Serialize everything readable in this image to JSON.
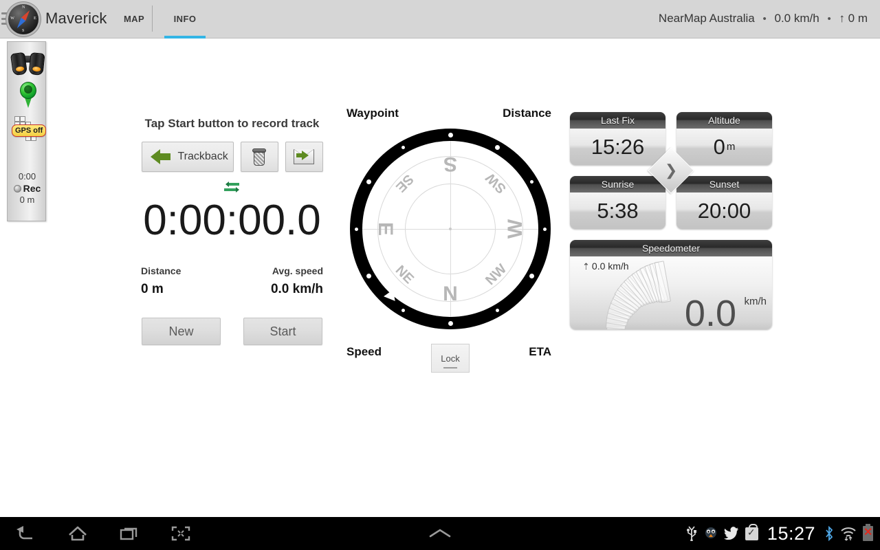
{
  "app": {
    "title": "Maverick",
    "icon": "compass-icon",
    "menu_icon": "hamburger-menu-icon"
  },
  "tabs": [
    {
      "label": "MAP",
      "active": false
    },
    {
      "label": "INFO",
      "active": true
    }
  ],
  "topbar_status": {
    "source": "NearMap Australia",
    "speed": "0.0 km/h",
    "altitude": "↑ 0 m",
    "separator": "•"
  },
  "sidepanel": {
    "binoculars_icon": "binoculars-icon",
    "waypoint_pin_icon": "map-pin-icon",
    "tiles_icon": "map-tiles-icon",
    "gps_badge": "GPS off",
    "time": "0:00",
    "rec_label": "Rec",
    "distance": "0 m"
  },
  "track": {
    "hint": "Tap Start button to record track",
    "trackback_label": "Trackback",
    "delete_icon": "trash-icon",
    "share_icon": "send-mail-icon",
    "sync_icon": "swap-arrows-icon",
    "timer": "0:00:00.0",
    "distance_label": "Distance",
    "distance_value": "0 m",
    "avg_speed_label": "Avg. speed",
    "avg_speed_value": "0.0 km/h",
    "new_label": "New",
    "start_label": "Start"
  },
  "compass": {
    "corner_labels": {
      "top_left": "Waypoint",
      "top_right": "Distance",
      "bottom_left": "Speed",
      "bottom_right": "ETA"
    },
    "lock_label": "Lock",
    "cardinals": [
      {
        "text": "N",
        "bearing": 180
      },
      {
        "text": "NE",
        "bearing": 225
      },
      {
        "text": "E",
        "bearing": 270
      },
      {
        "text": "SE",
        "bearing": 315
      },
      {
        "text": "S",
        "bearing": 0
      },
      {
        "text": "SW",
        "bearing": 45
      },
      {
        "text": "W",
        "bearing": 90
      },
      {
        "text": "NW",
        "bearing": 135
      }
    ],
    "heading_marker_bearing": 222
  },
  "dashboard": {
    "cards": [
      {
        "title": "Last Fix",
        "value": "15:26",
        "unit": ""
      },
      {
        "title": "Altitude",
        "value": "0",
        "unit": "m"
      },
      {
        "title": "Sunrise",
        "value": "5:38",
        "unit": ""
      },
      {
        "title": "Sunset",
        "value": "20:00",
        "unit": ""
      }
    ],
    "next_button_icon": "chevron-right-icon",
    "speedometer": {
      "title": "Speedometer",
      "max_speed": "0.0 km/h",
      "value": "0.0",
      "unit": "km/h"
    }
  },
  "system_bar": {
    "back_icon": "back-icon",
    "home_icon": "home-icon",
    "recents_icon": "recent-apps-icon",
    "screenshot_icon": "screenshot-icon",
    "expand_icon": "chevron-up-icon",
    "usb_icon": "usb-icon",
    "bird_icon": "bird-notification-icon",
    "twitter_icon": "twitter-icon",
    "store_icon": "play-store-check-icon",
    "clock": "15:27",
    "bluetooth_icon": "bluetooth-icon",
    "wifi_icon": "wifi-icon",
    "battery_icon": "battery-error-icon"
  },
  "colors": {
    "accent": "#33b5e5",
    "topbar_bg": "#d6d6d6",
    "green": "#5e8b21",
    "gps_badge_bg": "#f4d044",
    "gps_badge_border": "#c8342a"
  }
}
